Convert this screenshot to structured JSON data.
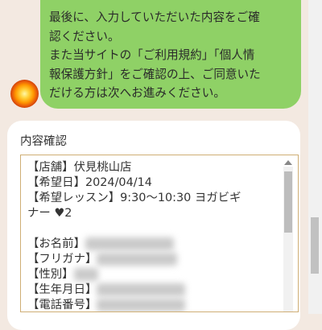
{
  "message": {
    "lines": [
      "最後に、入力していただいた内容をご確",
      "認ください。",
      "また当サイトの「ご利用規約」「個人情",
      "報保護方針」をご確認の上、ご同意いた",
      "だける方は次へお進みください。"
    ]
  },
  "card": {
    "label": "内容確認",
    "lines": [
      "【店舗】伏見桃山店",
      "【希望日】2024/04/14",
      "【希望レッスン】9:30〜10:30 ヨガビギ",
      "ナー ♥2",
      "",
      "【お名前】",
      "【フリガナ】",
      "【性別】",
      "【生年月日】",
      "【電話番号】"
    ]
  }
}
